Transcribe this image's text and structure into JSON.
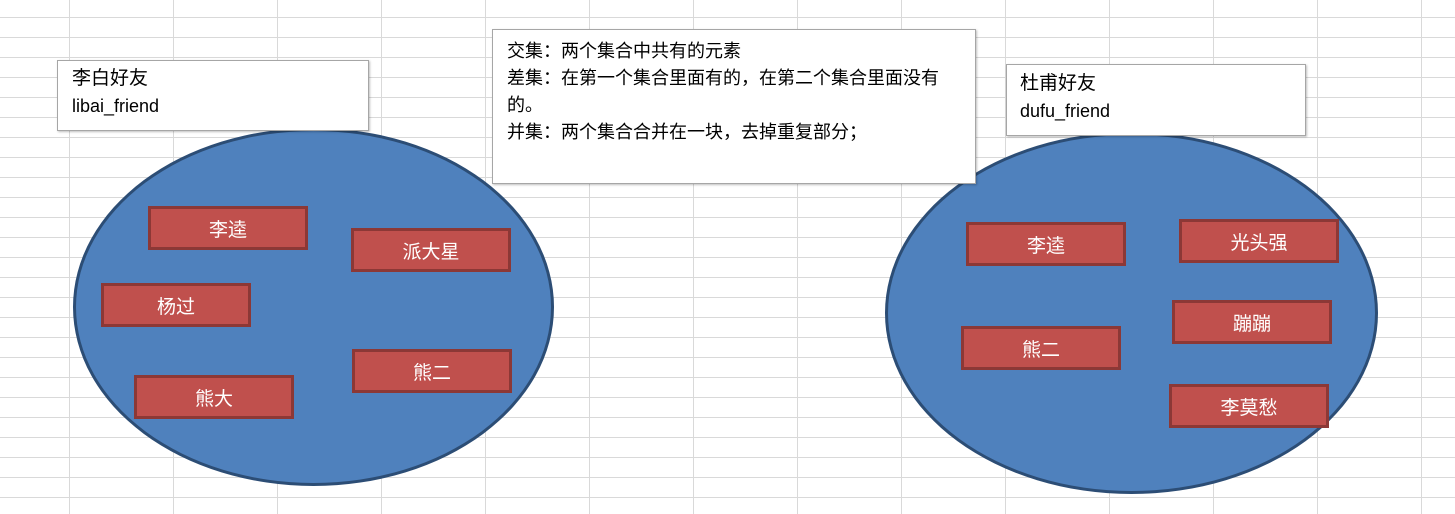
{
  "libai_label": {
    "title": "李白好友",
    "name": "libai_friend"
  },
  "dufu_label": {
    "title": "杜甫好友",
    "name": "dufu_friend"
  },
  "explanation": {
    "line1": "交集：两个集合中共有的元素",
    "line2": "差集：在第一个集合里面有的，在第二个集合里面没有的。",
    "line3": "并集：两个集合合并在一块，去掉重复部分；"
  },
  "libai_set": {
    "items": [
      "李逵",
      "派大星",
      "杨过",
      "熊二",
      "熊大"
    ]
  },
  "dufu_set": {
    "items": [
      "李逵",
      "光头强",
      "蹦蹦",
      "熊二",
      "李莫愁"
    ]
  },
  "colors": {
    "set_fill": "#4f81bd",
    "set_border": "#2c4d75",
    "element_fill": "#c0504d",
    "element_border": "#8c3836",
    "gridline": "#d9d9d9"
  }
}
